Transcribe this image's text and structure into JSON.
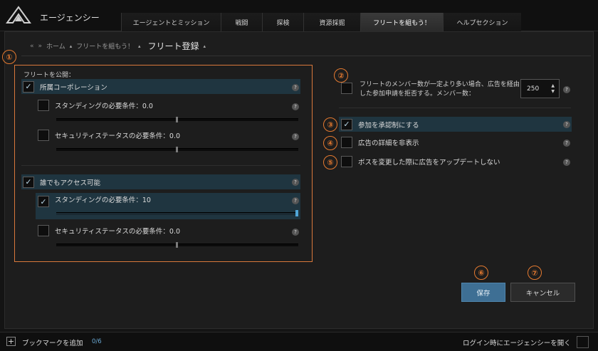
{
  "header": {
    "app_title": "エージェンシー",
    "tabs": [
      {
        "label": "エージェントとミッション"
      },
      {
        "label": "戦闘"
      },
      {
        "label": "探検"
      },
      {
        "label": "資源採掘"
      },
      {
        "label": "フリートを組もう！"
      },
      {
        "label": "ヘルプセクション"
      }
    ]
  },
  "breadcrumb": {
    "back": "«",
    "forward": "»",
    "home": "ホーム",
    "parent": "フリートを組もう！",
    "current": "フリート登録"
  },
  "annotations": [
    "①",
    "②",
    "③",
    "④",
    "⑤",
    "⑥",
    "⑦"
  ],
  "left": {
    "title": "フリートを公開：",
    "corp": {
      "label": "所属コーポレーション",
      "standing": {
        "label": "スタンディングの必要条件：0.0",
        "value": 0.0
      },
      "security": {
        "label": "セキュリティステータスの必要条件：0.0",
        "value": 0.0
      }
    },
    "public": {
      "label": "誰でもアクセス可能",
      "standing": {
        "label": "スタンディングの必要条件：10",
        "value": 10
      },
      "security": {
        "label": "セキュリティステータスの必要条件：0.0",
        "value": 0.0
      }
    }
  },
  "right": {
    "member_limit_text": "フリートのメンバー数が一定より多い場合、広告を経由した参加申請を拒否する。メンバー数：",
    "member_limit_value": "250",
    "approval_label": "参加を承認制にする",
    "hide_details_label": "広告の詳細を非表示",
    "no_update_label": "ボスを変更した際に広告をアップデートしない"
  },
  "buttons": {
    "save": "保存",
    "cancel": "キャンセル"
  },
  "help_glyph": "?",
  "check_glyph": "✓",
  "footer": {
    "add_bookmark": "ブックマークを追加",
    "bookmark_count": "0/6",
    "open_on_login": "ログイン時にエージェンシーを開く"
  }
}
